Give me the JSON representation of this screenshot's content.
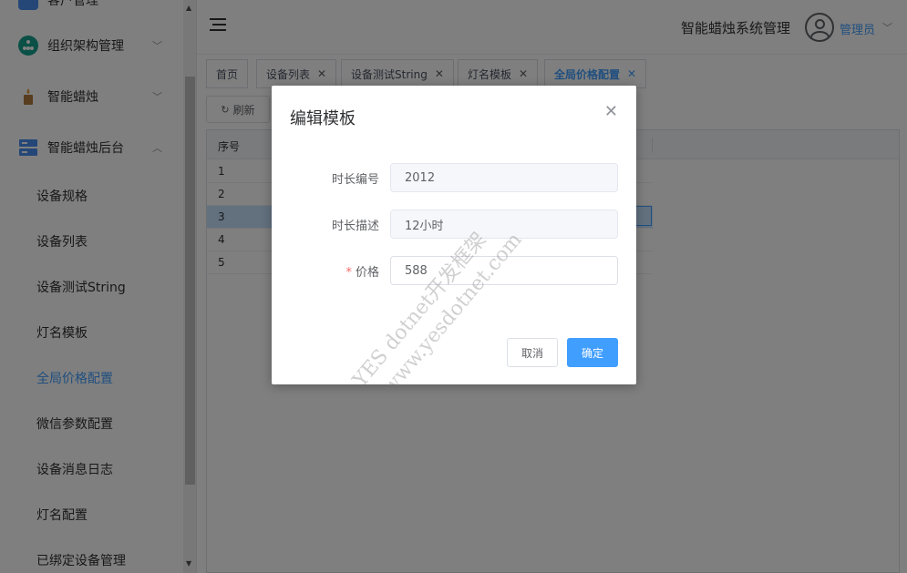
{
  "sidebar": {
    "top_partial_label": "客户管理",
    "groups": [
      {
        "label": "组织架构管理",
        "icon": "org-chart-icon",
        "icon_color": "#14a08c"
      },
      {
        "label": "智能蜡烛",
        "icon": "candle-icon",
        "icon_color": "#b07a3c"
      },
      {
        "label": "智能蜡烛后台",
        "icon": "server-icon",
        "icon_color": "#4a8ef0"
      }
    ],
    "subitems": [
      {
        "label": "设备规格"
      },
      {
        "label": "设备列表"
      },
      {
        "label": "设备测试String"
      },
      {
        "label": "灯名模板"
      },
      {
        "label": "全局价格配置",
        "active": true
      },
      {
        "label": "微信参数配置"
      },
      {
        "label": "设备消息日志"
      },
      {
        "label": "灯名配置"
      },
      {
        "label": "已绑定设备管理"
      }
    ]
  },
  "header": {
    "system_title": "智能蜡烛系统管理",
    "user_name": "管理员"
  },
  "tabs": [
    {
      "label": "首页",
      "closable": false
    },
    {
      "label": "设备列表",
      "closable": true
    },
    {
      "label": "设备测试String",
      "closable": true
    },
    {
      "label": "灯名模板",
      "closable": true
    },
    {
      "label": "全局价格配置",
      "closable": true,
      "active": true
    }
  ],
  "toolbar": {
    "refresh_label": "刷新"
  },
  "grid": {
    "index_header": "序号",
    "rows": [
      "1",
      "2",
      "3",
      "4",
      "5"
    ],
    "selected_row": "3"
  },
  "dialog": {
    "title": "编辑模板",
    "fields": [
      {
        "label": "时长编号",
        "value": "2012",
        "disabled": true,
        "required": false
      },
      {
        "label": "时长描述",
        "value": "12小时",
        "disabled": true,
        "required": false
      },
      {
        "label": "价格",
        "value": "588",
        "disabled": false,
        "required": true
      }
    ],
    "cancel_label": "取消",
    "confirm_label": "确定"
  },
  "watermark": {
    "line1": "YES dotnet开发框架",
    "line2": "www.yesdotnet.com"
  },
  "colors": {
    "accent": "#409eff",
    "required": "#f56c6c"
  }
}
